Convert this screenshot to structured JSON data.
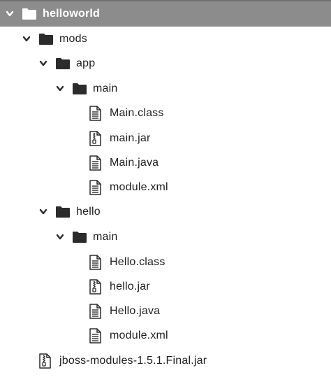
{
  "tree": {
    "root": {
      "label": "helloworld",
      "icon": "folder-icon",
      "expanded": true,
      "selected": true
    },
    "mods": {
      "label": "mods",
      "icon": "folder-icon",
      "expanded": true
    },
    "app": {
      "label": "app",
      "icon": "folder-icon",
      "expanded": true
    },
    "app_main": {
      "label": "main",
      "icon": "folder-icon",
      "expanded": true
    },
    "app_main_class": {
      "label": "Main.class",
      "icon": "file-text-icon"
    },
    "app_main_jar": {
      "label": "main.jar",
      "icon": "file-archive-icon"
    },
    "app_main_java": {
      "label": "Main.java",
      "icon": "file-text-icon"
    },
    "app_module_xml": {
      "label": "module.xml",
      "icon": "file-text-icon"
    },
    "hello": {
      "label": "hello",
      "icon": "folder-icon",
      "expanded": true
    },
    "hello_main": {
      "label": "main",
      "icon": "folder-icon",
      "expanded": true
    },
    "hello_class": {
      "label": "Hello.class",
      "icon": "file-text-icon"
    },
    "hello_jar": {
      "label": "hello.jar",
      "icon": "file-archive-icon"
    },
    "hello_java": {
      "label": "Hello.java",
      "icon": "file-text-icon"
    },
    "hello_module_xml": {
      "label": "module.xml",
      "icon": "file-text-icon"
    },
    "jboss_jar": {
      "label": "jboss-modules-1.5.1.Final.jar",
      "icon": "file-archive-icon"
    }
  },
  "colors": {
    "selection": "#8c8c8c",
    "icon": "#2b2b2b",
    "text": "#1e1e1e"
  }
}
